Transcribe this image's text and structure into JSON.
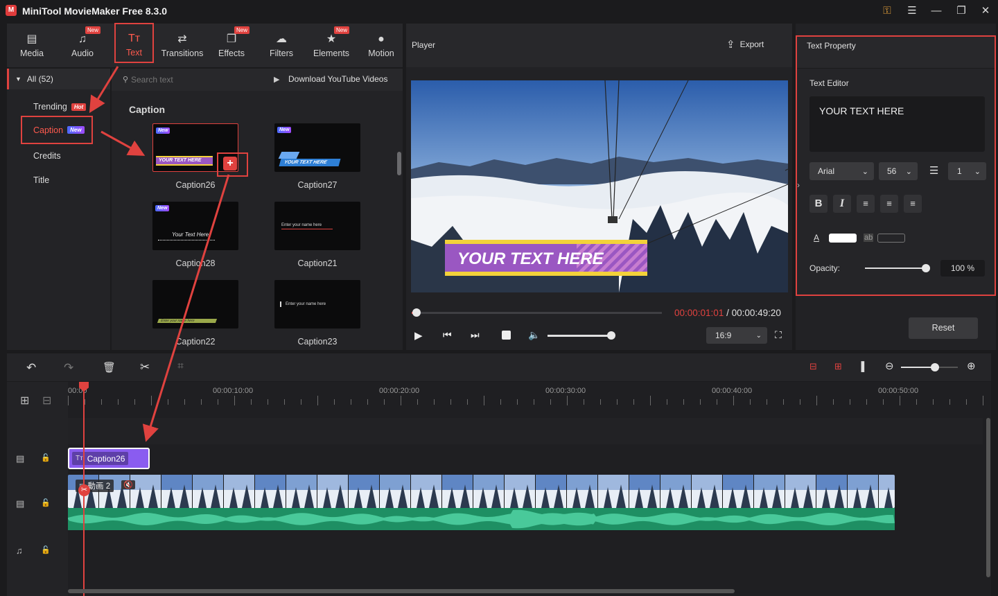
{
  "app": {
    "title": "MiniTool MovieMaker Free 8.3.0",
    "logo": "M"
  },
  "window_controls": [
    "key-icon",
    "menu-icon",
    "minimize-icon",
    "maximize-icon",
    "close-icon"
  ],
  "toolbar": {
    "tabs": [
      {
        "label": "Media",
        "icon": "▤",
        "new": false
      },
      {
        "label": "Audio",
        "icon": "♫",
        "new": true
      },
      {
        "label": "Text",
        "icon": "Tт",
        "new": false,
        "active": true
      },
      {
        "label": "Transitions",
        "icon": "⇄",
        "new": false
      },
      {
        "label": "Effects",
        "icon": "❐",
        "new": true
      },
      {
        "label": "Filters",
        "icon": "☁",
        "new": false
      },
      {
        "label": "Elements",
        "icon": "★",
        "new": true
      },
      {
        "label": "Motion",
        "icon": "●",
        "new": false
      }
    ],
    "new_label": "New"
  },
  "left_nav": {
    "all": "All (52)",
    "items": [
      {
        "label": "Trending",
        "badge": "Hot"
      },
      {
        "label": "Caption",
        "badge": "New",
        "active": true
      },
      {
        "label": "Credits"
      },
      {
        "label": "Title"
      }
    ]
  },
  "library": {
    "search_placeholder": "Search text",
    "download_label": "Download YouTube Videos",
    "section_title": "Caption",
    "thumbs": [
      {
        "label": "Caption26",
        "new": true,
        "sample": "YOUR TEXT HERE"
      },
      {
        "label": "Caption27",
        "new": true,
        "sample": "YOUR TEXT HERE"
      },
      {
        "label": "Caption28",
        "new": true,
        "sample": "Your Text Here"
      },
      {
        "label": "Caption21",
        "new": false,
        "sample": "Enter your name here"
      },
      {
        "label": "Caption22",
        "new": false,
        "sample": "Enter your name here"
      },
      {
        "label": "Caption23",
        "new": false,
        "sample": "Enter your name here"
      }
    ],
    "new_tag": "New"
  },
  "player": {
    "title": "Player",
    "export_label": "Export",
    "caption_text": "YOUR TEXT HERE",
    "current_time": "00:00:01:01",
    "separator": " / ",
    "total_time": "00:00:49:20",
    "progress_fraction": 0.02,
    "volume_fraction": 0.98,
    "aspect_ratio": "16:9"
  },
  "text_property": {
    "title": "Text Property",
    "editor_label": "Text Editor",
    "text_value": "YOUR TEXT HERE",
    "font": "Arial",
    "size": "56",
    "line_spacing": "1",
    "color_a_label": "A",
    "color_ab_label": "ab",
    "text_color": "#ffffff",
    "opacity_label": "Opacity:",
    "opacity_value": "100 %",
    "opacity_fraction": 1.0,
    "reset_label": "Reset"
  },
  "timeline": {
    "ruler_labels": [
      "00:00",
      "00:00:10:00",
      "00:00:20:00",
      "00:00:30:00",
      "00:00:40:00",
      "00:00:50:00"
    ],
    "text_clip_label": "Caption26",
    "video_clip_label": "動画 2",
    "zoom_fraction": 0.6
  },
  "colors": {
    "accent": "#e0423f",
    "clip_purple": "#8a5cf0",
    "audio_green": "#1e8f63",
    "caption_yellow": "#f3d23a",
    "caption_purple": "#9a57c2"
  }
}
